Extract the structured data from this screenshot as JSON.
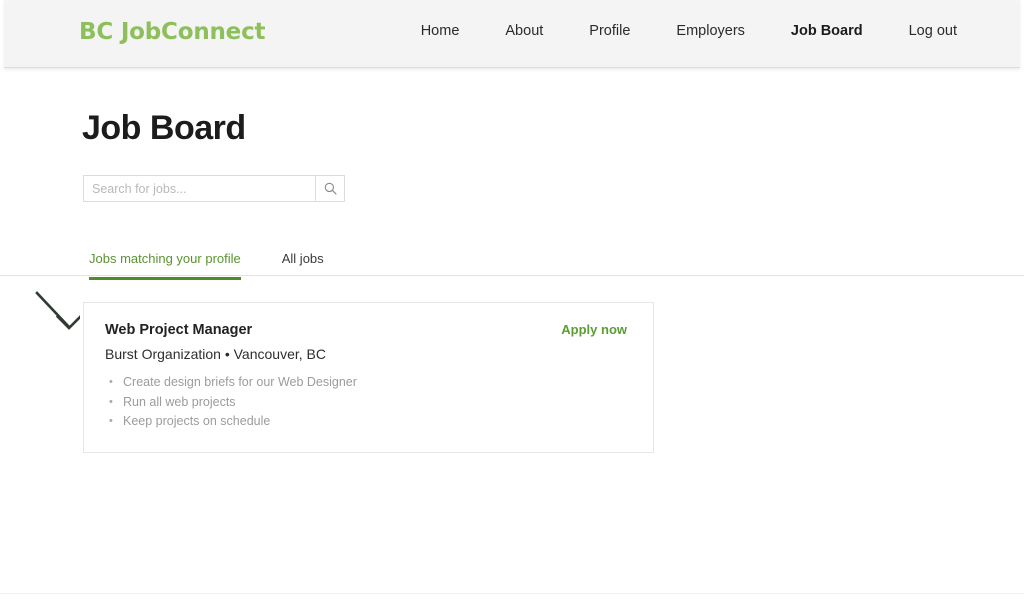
{
  "header": {
    "brand": {
      "prefix": "BC",
      "name": "JobConnect",
      "full": "BC JobConnect",
      "color": "#8dbf5a"
    },
    "nav": [
      {
        "label": "Home",
        "active": false
      },
      {
        "label": "About",
        "active": false
      },
      {
        "label": "Profile",
        "active": false
      },
      {
        "label": "Employers",
        "active": false
      },
      {
        "label": "Job Board",
        "active": true
      },
      {
        "label": "Log out",
        "active": false
      }
    ]
  },
  "main": {
    "page_title": "Job Board",
    "search": {
      "placeholder": "Search for jobs...",
      "value": "",
      "button_icon": "search-icon"
    },
    "tabs": [
      {
        "label": "Jobs matching your profile",
        "active": true
      },
      {
        "label": "All jobs",
        "active": false
      }
    ],
    "annotation": {
      "type": "arrow",
      "direction": "down-right",
      "points_to": "Jobs matching your profile",
      "color": "#2f3b33"
    },
    "jobs": [
      {
        "title": "Web Project Manager",
        "company": "Burst Organization",
        "location": "Vancouver, BC",
        "meta": "Burst Organization • Vancouver, BC",
        "bullets": [
          "Create design briefs for our Web Designer",
          "Run all web projects",
          "Keep projects on schedule"
        ],
        "apply_label": "Apply now"
      }
    ]
  },
  "colors": {
    "brand_green": "#8dbf5a",
    "accent_green": "#5a9e31",
    "tab_active_green": "#5a9430",
    "tab_underline": "#4e8c28",
    "header_bg": "#f4f4f4",
    "text_dark": "#1c1c1c",
    "text_muted": "#9c9c9c",
    "border": "#e6e6e6"
  }
}
